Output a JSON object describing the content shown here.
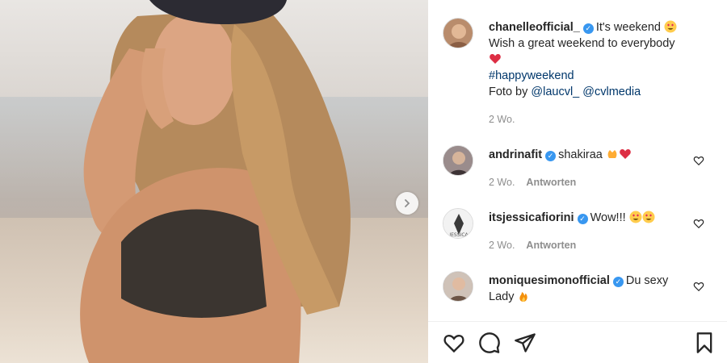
{
  "post": {
    "next_button": "next-image",
    "caption": {
      "username": "chanelleofficial_",
      "line1": "It's weekend",
      "line2": "Wish a great weekend to everybody",
      "hashtag": "#happyweekend",
      "credit_prefix": "Foto by",
      "mention1": "@laucvl_",
      "mention2": "@cvlmedia",
      "time": "2 Wo."
    },
    "comments": [
      {
        "username": "andrinafit",
        "text": "shakiraa",
        "time": "2 Wo.",
        "reply": "Antworten"
      },
      {
        "username": "itsjessicafiorini",
        "text": "Wow!!!",
        "time": "2 Wo.",
        "reply": "Antworten"
      },
      {
        "username": "moniquesimonofficial",
        "text": "Du sexy",
        "text2": "Lady"
      }
    ]
  },
  "colors": {
    "verified": "#3897f0",
    "link": "#00376b",
    "muted": "#8e8e8e",
    "heart_red": "#ed4956"
  },
  "icons": [
    "chevron-right-icon",
    "heart-icon",
    "comment-icon",
    "share-icon",
    "bookmark-icon",
    "verified-badge-icon"
  ]
}
